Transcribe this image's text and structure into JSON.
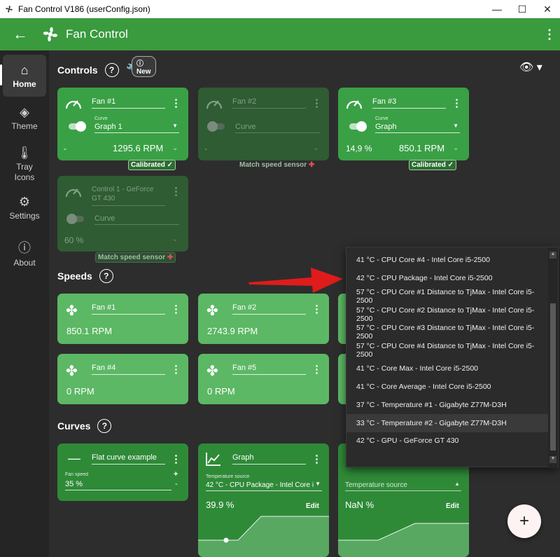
{
  "window": {
    "title": "Fan Control V186 (userConfig.json)",
    "min": "—",
    "max": "☐",
    "close": "✕"
  },
  "appbar": {
    "back": "←",
    "title": "Fan Control",
    "menu": "⋮"
  },
  "nav": {
    "home": "Home",
    "theme": "Theme",
    "tray": "Tray Icons",
    "settings": "Settings",
    "about": "About"
  },
  "controls": {
    "title": "Controls",
    "help": "?",
    "new_badge": "New",
    "cards": [
      {
        "name": "Fan #1",
        "curve_label": "Curve",
        "curve": "Graph 1",
        "percent": "-",
        "rpm": "1295.6 RPM",
        "badge": "Calibrated",
        "enabled": true
      },
      {
        "name": "Fan #2",
        "curve_label": "",
        "curve": "Curve",
        "percent": "-",
        "rpm": "",
        "badge": "Match speed sensor",
        "enabled": false
      },
      {
        "name": "Fan #3",
        "curve_label": "Curve",
        "curve": "Graph",
        "percent": "14,9 %",
        "rpm": "850.1 RPM",
        "badge": "Calibrated",
        "enabled": true
      },
      {
        "name": "Control 1 - GeForce GT 430",
        "curve_label": "",
        "curve": "Curve",
        "percent": "60 %",
        "rpm": "",
        "badge": "Match speed sensor",
        "enabled": false
      }
    ]
  },
  "speeds": {
    "title": "Speeds",
    "help": "?",
    "cards": [
      {
        "name": "Fan #1",
        "rpm": "850.1 RPM"
      },
      {
        "name": "Fan #2",
        "rpm": "2743.9 RPM"
      },
      {
        "name": "Fan #4",
        "rpm": "0 RPM"
      },
      {
        "name": "Fan #5",
        "rpm": "0 RPM"
      }
    ]
  },
  "curves": {
    "title": "Curves",
    "help": "?",
    "cards": [
      {
        "name": "Flat curve example",
        "field_label": "Fan speed",
        "field_value": "35 %",
        "plus": "+",
        "minus": "-"
      },
      {
        "name": "Graph",
        "field_label": "Temperature source",
        "field_value": "42 °C - CPU Package - Intel Core i",
        "value": "39.9 %",
        "edit": "Edit"
      },
      {
        "name": "",
        "field_label": "",
        "field_value": "Temperature source",
        "value": "NaN %",
        "edit": "Edit"
      }
    ]
  },
  "dropdown": {
    "items": [
      "41 °C - CPU Core #4 - Intel Core i5-2500",
      "42 °C - CPU Package - Intel Core i5-2500",
      "57 °C - CPU Core #1 Distance to TjMax - Intel Core i5-2500",
      "57 °C - CPU Core #2 Distance to TjMax - Intel Core i5-2500",
      "57 °C - CPU Core #3 Distance to TjMax - Intel Core i5-2500",
      "57 °C - CPU Core #4 Distance to TjMax - Intel Core i5-2500",
      "41 °C - Core Max - Intel Core i5-2500",
      "41 °C - Core Average - Intel Core i5-2500",
      "37 °C - Temperature #1 - Gigabyte Z77M-D3H",
      "33 °C - Temperature #2 - Gigabyte Z77M-D3H",
      "42 °C - GPU - GeForce GT 430"
    ],
    "hover_index": 9
  },
  "fab": "+",
  "colors": {
    "accent": "#3a9a3e",
    "arrow": "#e01b1b",
    "badge_plus": "#e05050"
  }
}
